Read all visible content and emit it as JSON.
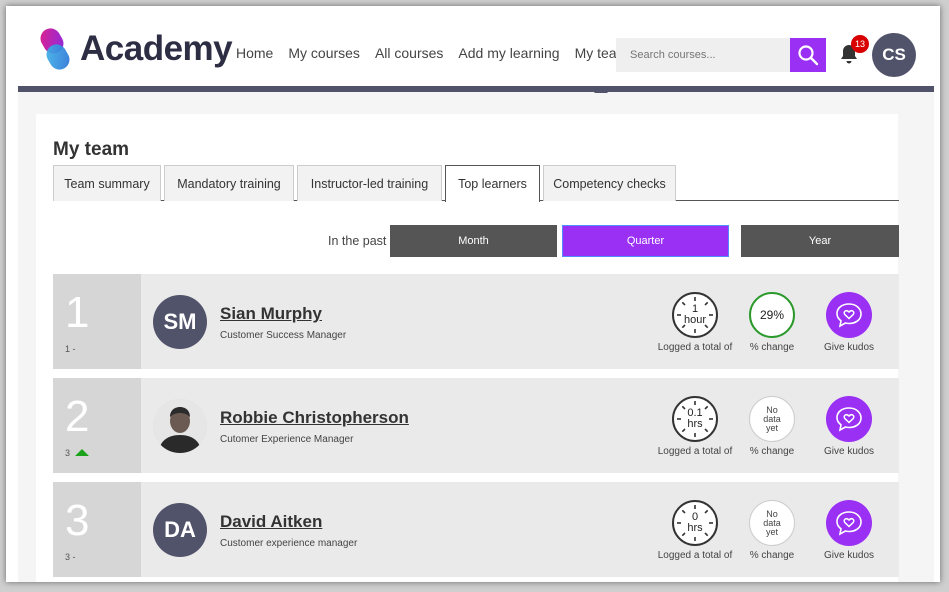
{
  "app": {
    "logo_text": "Academy",
    "nav": [
      "Home",
      "My courses",
      "All courses",
      "Add my learning",
      "My team"
    ],
    "search_placeholder": "Search courses...",
    "notification_count": "13",
    "user_initials": "CS"
  },
  "page": {
    "title": "My team",
    "tabs": [
      "Team summary",
      "Mandatory training",
      "Instructor-led training",
      "Top learners",
      "Competency checks"
    ],
    "active_tab": "Top learners",
    "period_label": "In the past",
    "periods": [
      "Month",
      "Quarter",
      "Year"
    ],
    "active_period": "Quarter"
  },
  "learners": [
    {
      "rank": "1",
      "prev": "1 -",
      "initials": "SM",
      "name": "Sian Murphy",
      "role": "Customer Success Manager",
      "logged": "1",
      "unit": "hour",
      "change": "29%",
      "change_word_1": "",
      "change_word_2": "",
      "change_word_3": ""
    },
    {
      "rank": "2",
      "prev": "3",
      "initials": "",
      "name": "Robbie Christopherson",
      "role": "Cutomer Experience Manager",
      "logged": "0.1",
      "unit": "hrs",
      "change": "",
      "change_word_1": "No",
      "change_word_2": "data",
      "change_word_3": "yet"
    },
    {
      "rank": "3",
      "prev": "3 -",
      "initials": "DA",
      "name": "David Aitken",
      "role": "Customer experience manager",
      "logged": "0",
      "unit": "hrs",
      "change": "",
      "change_word_1": "No",
      "change_word_2": "data",
      "change_word_3": "yet"
    }
  ],
  "labels": {
    "logged": "Logged a total of",
    "change": "% change",
    "kudos": "Give kudos"
  },
  "colors": {
    "accent": "#9b30f5",
    "header_bar": "#51536b",
    "positive": "#2b9a2b"
  }
}
